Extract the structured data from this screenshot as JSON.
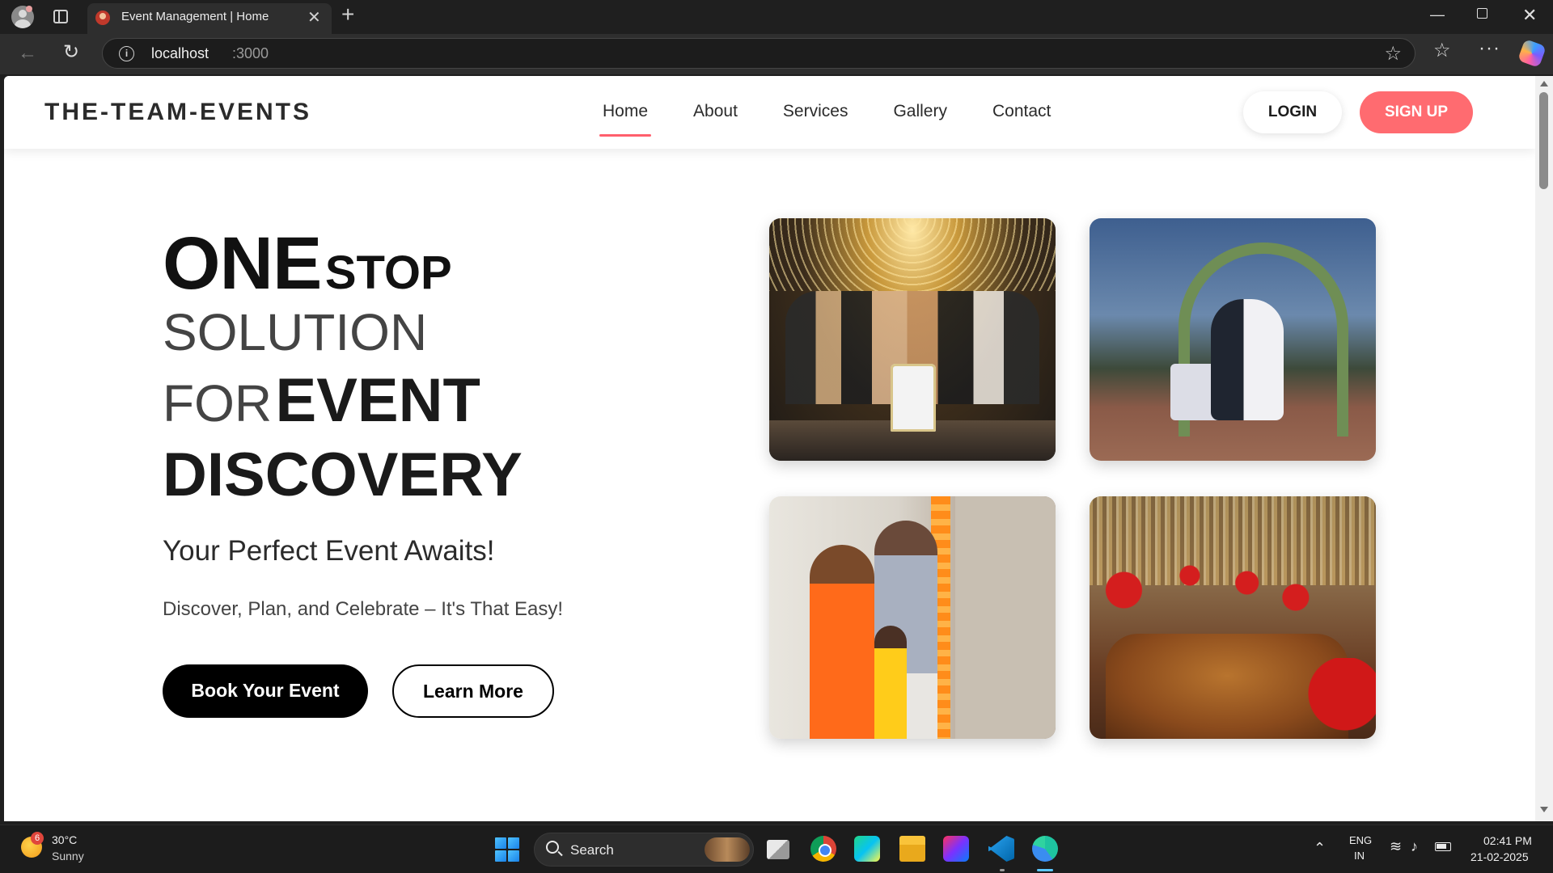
{
  "browser": {
    "tab_title": "Event Management | Home",
    "url_host": "localhost",
    "url_port": ":3000"
  },
  "site": {
    "brand": "THE-TEAM-EVENTS",
    "nav": [
      "Home",
      "About",
      "Services",
      "Gallery",
      "Contact"
    ],
    "active_nav": "Home",
    "login": "LOGIN",
    "signup": "SIGN UP",
    "accent_color": "#ff6b70"
  },
  "hero": {
    "word_one": "ONE",
    "word_stop": "STOP",
    "word_solution": "SOLUTION",
    "word_for": "FOR",
    "word_event": "EVENT",
    "word_discovery": "DISCOVERY",
    "tagline": "Your Perfect Event Awaits!",
    "subline": "Discover, Plan, and Celebrate – It's That Easy!",
    "primary_button": "Book Your Event",
    "secondary_button": "Learn More"
  },
  "taskbar": {
    "weather_temp": "30°C",
    "weather_cond": "Sunny",
    "weather_badge": "6",
    "search_label": "Search",
    "lang_line1": "ENG",
    "lang_line2": "IN",
    "time": "02:41 PM",
    "date": "21-02-2025"
  }
}
